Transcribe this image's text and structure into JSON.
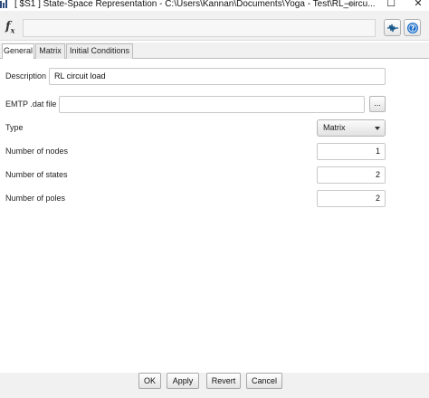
{
  "window": {
    "title": "[ $S1 ]  State-Space Representation - C:\\Users\\Kannan\\Documents\\Yoga - Test\\RL_circu...",
    "minimize": "—",
    "maximize": "☐",
    "close": "✕"
  },
  "toolbar": {
    "fx_label": "f",
    "fx_sub": "x",
    "formula_value": ""
  },
  "tabs": [
    {
      "label": "General",
      "active": true
    },
    {
      "label": "Matrix",
      "active": false
    },
    {
      "label": "Initial Conditions",
      "active": false
    }
  ],
  "form": {
    "description": {
      "label": "Description",
      "value": "RL circuit load"
    },
    "emtp_file": {
      "label": "EMTP .dat file",
      "value": "",
      "browse_label": "..."
    },
    "type": {
      "label": "Type",
      "selected": "Matrix"
    },
    "num_nodes": {
      "label": "Number of nodes",
      "value": "1"
    },
    "num_states": {
      "label": "Number of states",
      "value": "2"
    },
    "num_poles": {
      "label": "Number of poles",
      "value": "2"
    }
  },
  "buttons": {
    "ok": "OK",
    "apply": "Apply",
    "revert": "Revert",
    "cancel": "Cancel"
  },
  "colors": {
    "help_icon": "#1e6fc9",
    "scope_icon": "#1a5a8a"
  }
}
